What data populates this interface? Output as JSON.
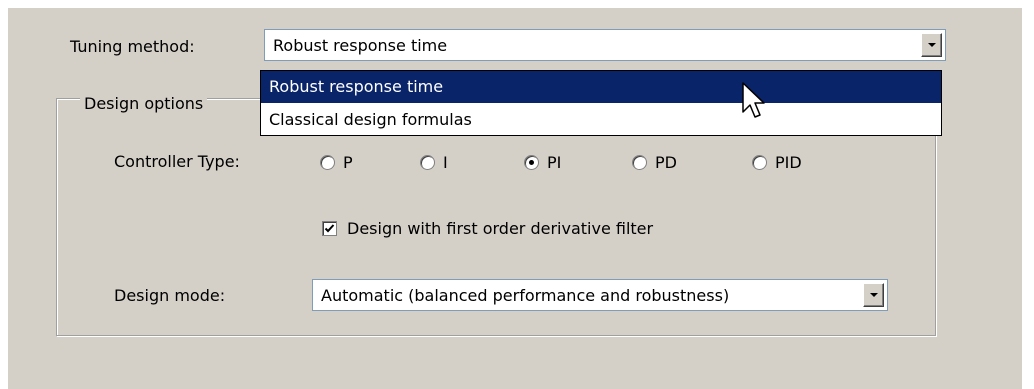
{
  "tuning": {
    "label": "Tuning method:",
    "value": "Robust response time",
    "options": [
      "Robust response time",
      "Classical design formulas"
    ],
    "selected_index": 0
  },
  "design_options": {
    "title": "Design options",
    "controller_type": {
      "label": "Controller Type:",
      "options": [
        "P",
        "I",
        "PI",
        "PD",
        "PID"
      ],
      "selected": "PI"
    },
    "derivative_filter": {
      "label": "Design with first order derivative filter",
      "checked": true
    },
    "design_mode": {
      "label": "Design mode:",
      "value": "Automatic (balanced performance and robustness)"
    }
  },
  "colors": {
    "panel_bg": "#d4d0c8",
    "selection_bg": "#0a246a",
    "selection_fg": "#ffffff"
  },
  "icons": {
    "dropdown_arrow": "chevron-down-icon",
    "cursor": "mouse-pointer-icon",
    "radio_selected": "radio-dot-icon",
    "checkbox_checked": "checkmark-icon"
  }
}
